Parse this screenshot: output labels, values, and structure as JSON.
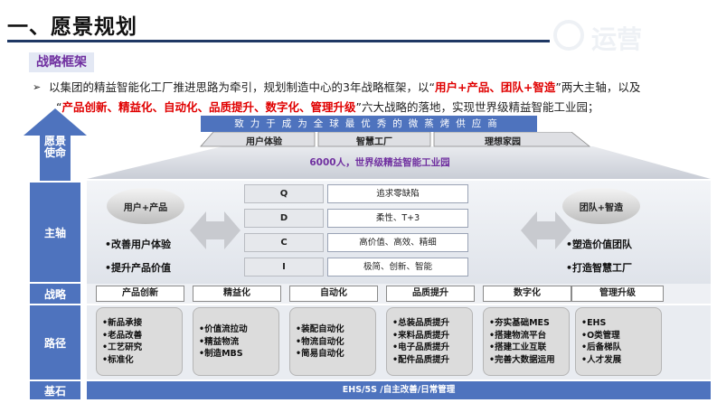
{
  "title": "一、愿景规划",
  "logo": {
    "text": "运营"
  },
  "section_label": "战略框架",
  "intro": {
    "bullet": "➢",
    "p1": "以集团的精益智能化工厂推进思路为牵引，规划制造中心的3年战略框架，以“",
    "p1_red": "用户+产品、团队+智造",
    "p2": "”两大主轴，以及",
    "p3": "“",
    "p3_red": "产品创新、精益化、自动化、品质提升、数字化、管理升级",
    "p4": "”六大战略的落地，实现世界级精益智能工业园；"
  },
  "left_labels": {
    "vision": "愿景\n使命",
    "main_axis": "主轴",
    "strategy": "战略",
    "path": "路径",
    "foundation": "基石"
  },
  "mission_banner": "致力于成为全球最优秀的微蒸烤供应商",
  "tabs": [
    "用户体验",
    "智慧工厂",
    "理想家园"
  ],
  "goal": "6000人，世界级精益智能工业园",
  "left_axis": {
    "oval": "用户+产品",
    "items": [
      "•改善用户体验",
      "•提升产品价值"
    ]
  },
  "right_axis": {
    "oval": "团队+智造",
    "items": [
      "•塑造价值团队",
      "•打造智慧工厂"
    ]
  },
  "qdci": [
    {
      "key": "Q",
      "value": "追求零缺陷"
    },
    {
      "key": "D",
      "value": "柔性、T+3"
    },
    {
      "key": "C",
      "value": "高价值、高效、精细"
    },
    {
      "key": "I",
      "value": "极简、创新、智能"
    }
  ],
  "strategies": [
    "产品创新",
    "精益化",
    "自动化",
    "品质提升",
    "数字化",
    "管理升级"
  ],
  "paths": [
    [
      "•新品承接",
      "•老品改善",
      "•工艺研究",
      "•标准化"
    ],
    [
      "•价值流拉动",
      "•精益物流",
      "•制造MBS"
    ],
    [
      "•装配自动化",
      "•物流自动化",
      "•简易自动化"
    ],
    [
      "•总装品质提升",
      "•来料品质提升",
      "•电子品质提升",
      "•配件品质提升"
    ],
    [
      "•夯实基础MES",
      "•搭建物流平台",
      "•搭建工业互联",
      "•完善大数据运用"
    ],
    [
      "•EHS",
      "•O类管理",
      "•后备梯队",
      "•人才发展"
    ]
  ],
  "foundation": "EHS/5S /自主改善/日常管理",
  "colors": {
    "primary_blue": "#4e73be",
    "accent_purple": "#7030a0",
    "accent_red": "#e00000"
  }
}
